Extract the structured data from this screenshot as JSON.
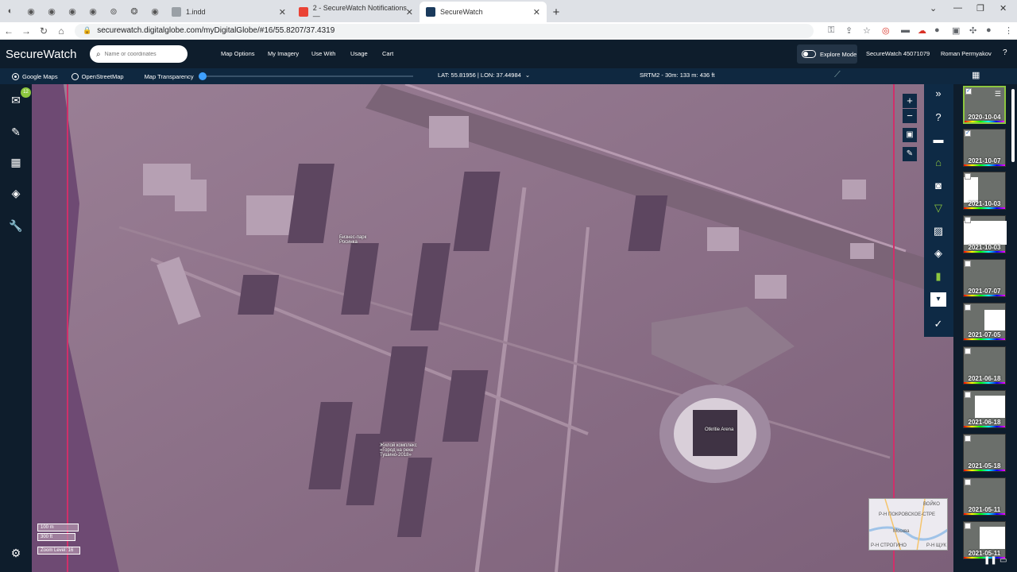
{
  "browser": {
    "tabs": [
      {
        "label": "1.indd",
        "color": "#5f6368"
      },
      {
        "label": "2 - SecureWatch Notifications —",
        "color": "#ea4335"
      },
      {
        "label": "SecureWatch",
        "color": "#1a73e8"
      }
    ],
    "url": "securewatch.digitalglobe.com/myDigitalGlobe/#16/55.8207/37.4319"
  },
  "header": {
    "brand": "SecureWatch",
    "search_placeholder": "Name or coordinates",
    "menu": [
      "Map Options",
      "My Imagery",
      "Use With",
      "Usage",
      "Cart"
    ],
    "explore_mode": "Explore Mode",
    "account": "SecureWatch 45071079",
    "user": "Roman Permyakov",
    "help": "?"
  },
  "basemap": {
    "google": "Google Maps",
    "osm": "OpenStreetMap",
    "transparency": "Map Transparency",
    "latlon": "LAT: 55.81956 | LON: 37.44984",
    "srtm": "SRTM2 - 30m: 133 m: 436 ft"
  },
  "sidebar": {
    "badge": "12"
  },
  "map": {
    "labels": [
      {
        "text": "Otkritie Arena"
      },
      {
        "text": "Жилой комплекс «Город на реке Тушино-2018»"
      },
      {
        "text": "Бизнес-парк Росинка"
      }
    ],
    "scale_m": "100 m",
    "scale_ft": "300 ft",
    "zoom": "Zoom Level: 16"
  },
  "minimap": {
    "labels": [
      "ВОЙКО",
      "Р-Н ПОКРОВСКОЕ-СТРЕ",
      "Москва",
      "Р-Н СТРОГИНО",
      "Р-Н ЩУК"
    ]
  },
  "thumbnails": [
    {
      "date": "2020-10-04",
      "checked": true,
      "selected": true
    },
    {
      "date": "2021-10-07",
      "checked": true,
      "selected": false
    },
    {
      "date": "2021-10-03",
      "checked": false,
      "selected": false
    },
    {
      "date": "2021-10-03",
      "checked": false,
      "selected": false
    },
    {
      "date": "2021-07-07",
      "checked": false,
      "selected": false
    },
    {
      "date": "2021-07-05",
      "checked": false,
      "selected": false
    },
    {
      "date": "2021-06-18",
      "checked": false,
      "selected": false
    },
    {
      "date": "2021-06-18",
      "checked": false,
      "selected": false
    },
    {
      "date": "2021-05-18",
      "checked": false,
      "selected": false
    },
    {
      "date": "2021-05-11",
      "checked": false,
      "selected": false
    },
    {
      "date": "2021-05-11",
      "checked": false,
      "selected": false
    }
  ],
  "colors": {
    "accent": "#8cc63f",
    "header": "#0e1d2c",
    "map_tint": "#8a6f87",
    "aoi": "#d0306a"
  }
}
